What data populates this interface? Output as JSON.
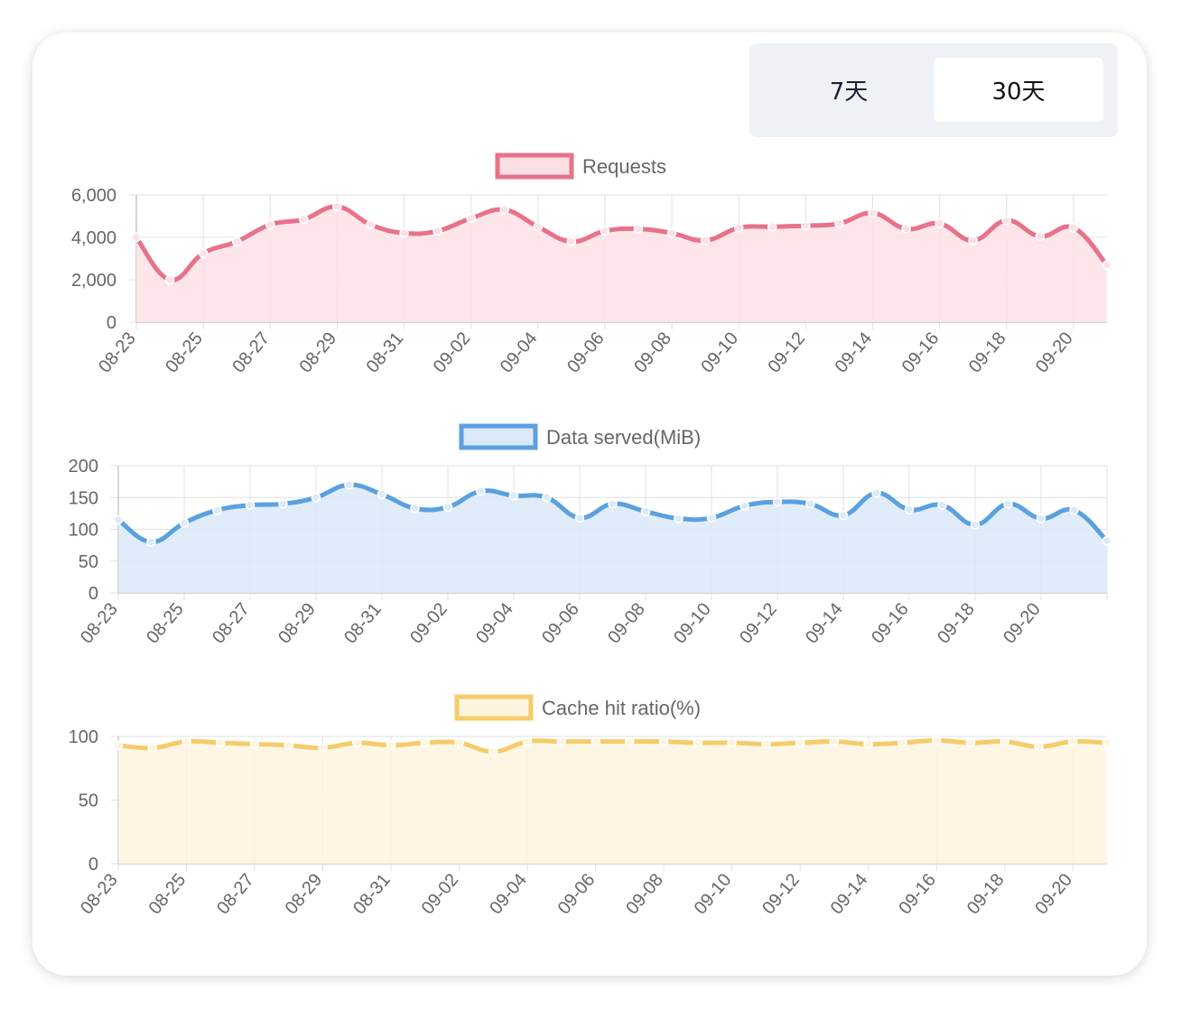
{
  "range_selector": {
    "option_7": "7天",
    "option_30": "30天",
    "selected": "30天"
  },
  "chart_data": [
    {
      "type": "line",
      "series": [
        {
          "name": "Requests",
          "values": [
            4000,
            2000,
            3250,
            3800,
            4600,
            4850,
            5450,
            4600,
            4200,
            4300,
            4900,
            5300,
            4500,
            3800,
            4300,
            4400,
            4200,
            3850,
            4450,
            4500,
            4550,
            4650,
            5150,
            4400,
            4650,
            3850,
            4800,
            4050,
            4450,
            2700
          ]
        }
      ],
      "x": [
        "08-23",
        "08-24",
        "08-25",
        "08-26",
        "08-27",
        "08-28",
        "08-29",
        "08-30",
        "08-31",
        "09-01",
        "09-02",
        "09-03",
        "09-04",
        "09-05",
        "09-06",
        "09-07",
        "09-08",
        "09-09",
        "09-10",
        "09-11",
        "09-12",
        "09-13",
        "09-14",
        "09-15",
        "09-16",
        "09-17",
        "09-18",
        "09-19",
        "09-20",
        "09-21"
      ],
      "x_tick_labels": [
        "08-23",
        "08-25",
        "08-27",
        "08-29",
        "08-31",
        "09-02",
        "09-04",
        "09-06",
        "09-08",
        "09-10",
        "09-12",
        "09-14",
        "09-16",
        "09-18",
        "09-20"
      ],
      "y_tick_labels": [
        "0",
        "2,000",
        "4,000",
        "6,000"
      ],
      "ylim": [
        0,
        6000
      ],
      "legend_placement": "top",
      "grid": true,
      "fill": true,
      "colors": {
        "line": "#e8728a",
        "fill": "#fde0e6"
      }
    },
    {
      "type": "line",
      "series": [
        {
          "name": "Data served(MiB)",
          "values": [
            115,
            80,
            110,
            130,
            138,
            140,
            150,
            170,
            155,
            133,
            135,
            160,
            153,
            150,
            118,
            140,
            128,
            117,
            118,
            137,
            143,
            140,
            122,
            157,
            131,
            138,
            107,
            140,
            117,
            130,
            82
          ]
        }
      ],
      "x": [
        "08-23",
        "08-24",
        "08-25",
        "08-26",
        "08-27",
        "08-28",
        "08-29",
        "08-30",
        "08-31",
        "09-01",
        "09-02",
        "09-03",
        "09-04",
        "09-05",
        "09-06",
        "09-07",
        "09-08",
        "09-09",
        "09-10",
        "09-11",
        "09-12",
        "09-13",
        "09-14",
        "09-15",
        "09-16",
        "09-17",
        "09-18",
        "09-19",
        "09-20",
        "09-21"
      ],
      "x_tick_labels": [
        "08-23",
        "08-25",
        "08-27",
        "08-29",
        "08-31",
        "09-02",
        "09-04",
        "09-06",
        "09-08",
        "09-10",
        "09-12",
        "09-14",
        "09-16",
        "09-18",
        "09-20"
      ],
      "y_tick_labels": [
        "0",
        "50",
        "100",
        "150",
        "200"
      ],
      "ylim": [
        0,
        200
      ],
      "legend_placement": "top",
      "grid": true,
      "fill": true,
      "colors": {
        "line": "#5ba0e0",
        "fill": "#dbe9f8"
      }
    },
    {
      "type": "line",
      "series": [
        {
          "name": "Cache hit ratio(%)",
          "values": [
            93,
            91,
            96,
            95,
            94,
            93,
            91,
            95,
            93,
            95,
            95,
            88,
            96,
            96,
            96,
            96,
            96,
            95,
            95,
            94,
            95,
            96,
            94,
            95,
            97,
            95,
            96,
            92,
            96,
            95
          ]
        }
      ],
      "x": [
        "08-23",
        "08-24",
        "08-25",
        "08-26",
        "08-27",
        "08-28",
        "08-29",
        "08-30",
        "08-31",
        "09-01",
        "09-02",
        "09-03",
        "09-04",
        "09-05",
        "09-06",
        "09-07",
        "09-08",
        "09-09",
        "09-10",
        "09-11",
        "09-12",
        "09-13",
        "09-14",
        "09-15",
        "09-16",
        "09-17",
        "09-18",
        "09-19",
        "09-20",
        "09-21"
      ],
      "x_tick_labels": [
        "08-23",
        "08-25",
        "08-27",
        "08-29",
        "08-31",
        "09-02",
        "09-04",
        "09-06",
        "09-08",
        "09-10",
        "09-12",
        "09-14",
        "09-16",
        "09-18",
        "09-20"
      ],
      "y_tick_labels": [
        "0",
        "50",
        "100"
      ],
      "ylim": [
        0,
        100
      ],
      "legend_placement": "top",
      "grid": true,
      "fill": true,
      "colors": {
        "line": "#f5cc6a",
        "fill": "#fdf4df"
      }
    }
  ]
}
